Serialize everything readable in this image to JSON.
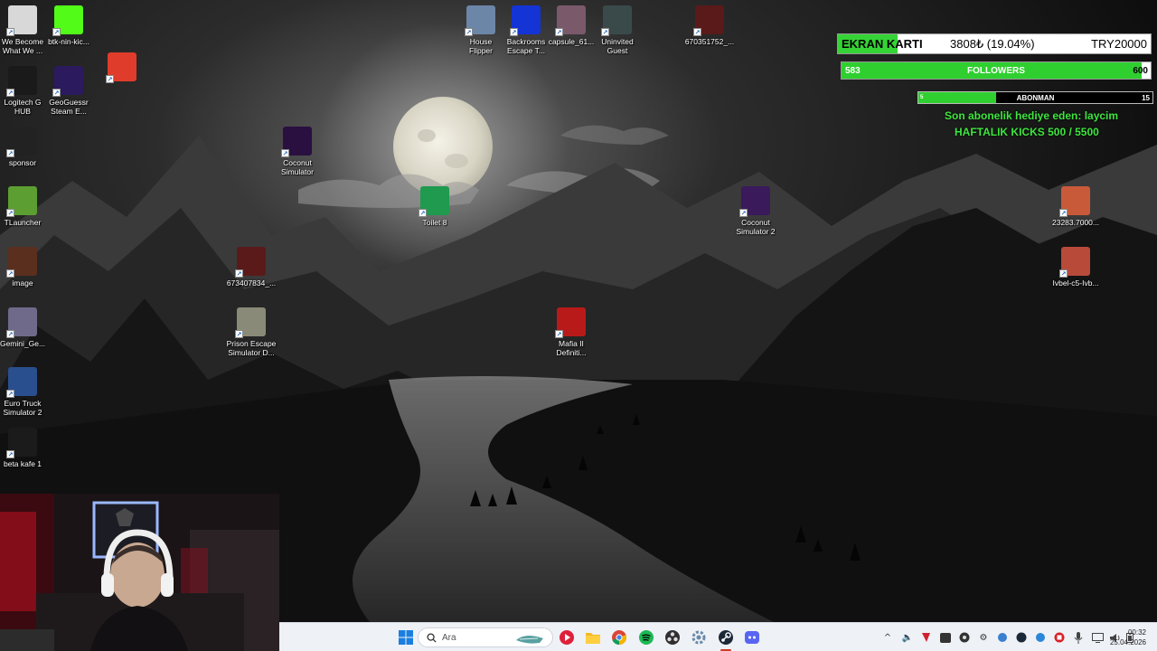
{
  "desktop": {
    "icons": [
      {
        "label": "We Become\nWhat We ...",
        "icon": "we-become-icon",
        "color": "#d8d8d8"
      },
      {
        "label": "btk-nin-kic...",
        "icon": "kick-k-icon",
        "color": "#53fc18"
      },
      {
        "label": "Logitech G\nHUB",
        "icon": "logitech-g-icon",
        "color": "#1a1a1a"
      },
      {
        "label": "GeoGuessr\nSteam E...",
        "icon": "geoguessr-pin-icon",
        "color": "#2b1a5e"
      },
      {
        "label": "",
        "icon": "pencil-stripe-icon",
        "color": "#e03c2c"
      },
      {
        "label": "sponsor",
        "icon": "sponsor-gear-icon",
        "color": "#222"
      },
      {
        "label": "TLauncher",
        "icon": "tlauncher-grass-icon",
        "color": "#5c9e31"
      },
      {
        "label": "image",
        "icon": "image-thumb-icon",
        "color": "#5a2f1e"
      },
      {
        "label": "Gemini_Ge...",
        "icon": "gemini-image-icon",
        "color": "#6f6a8a"
      },
      {
        "label": "Euro Truck\nSimulator 2",
        "icon": "truck-icon",
        "color": "#2a4f8f"
      },
      {
        "label": "beta kafe 1",
        "icon": "video-file-icon",
        "color": "#1b1b1b"
      },
      {
        "label": "House\nFlipper",
        "icon": "house-flipper-icon",
        "color": "#6c86a8"
      },
      {
        "label": "Backrooms\nEscape T...",
        "icon": "backrooms-bet-icon",
        "color": "#1434d6"
      },
      {
        "label": "capsule_61...",
        "icon": "capsule-image-icon",
        "color": "#7a5a6a"
      },
      {
        "label": "Uninvited\nGuest",
        "icon": "uninvited-guest-icon",
        "color": "#3a4a4a"
      },
      {
        "label": "670351752_...",
        "icon": "photo-file-icon",
        "color": "#5a1a1a"
      },
      {
        "label": "Coconut\nSimulator",
        "icon": "coconut-icon",
        "color": "#2a1040"
      },
      {
        "label": "Toilet 8",
        "icon": "toilet-8-icon",
        "color": "#1f9a4e"
      },
      {
        "label": "Coconut\nSimulator 2",
        "icon": "coconut-2-icon",
        "color": "#3a1a5a"
      },
      {
        "label": "673407834_...",
        "icon": "photo-file-2-icon",
        "color": "#5a1a1a"
      },
      {
        "label": "Prison Escape\nSimulator D...",
        "icon": "prison-escape-icon",
        "color": "#8a8a78"
      },
      {
        "label": "Mafia II\nDefiniti...",
        "icon": "mafia-ii-icon",
        "color": "#b81a1a"
      },
      {
        "label": "23283.7000...",
        "icon": "portrait-photo-icon",
        "color": "#c85a3a"
      },
      {
        "label": "Ivbel-c5-Ivb...",
        "icon": "portrait-photo-2-icon",
        "color": "#b84a3a"
      }
    ]
  },
  "overlay": {
    "gpu": {
      "label": "EKRAN KARTI",
      "value": "3808₺ (19.04%)",
      "goal": "TRY20000",
      "progress_pct": 19.04
    },
    "followers": {
      "current": "583",
      "label": "FOLLOWERS",
      "goal": "600",
      "progress_pct": 97.2
    },
    "subs": {
      "current": "5",
      "label": "ABONMAN",
      "goal": "15",
      "progress_pct": 33.3
    },
    "gift_text": "Son abonelik hediye eden: laycim",
    "weekly_text": "HAFTALIK KICKS 500 / 5500",
    "accent_color": "#35d335"
  },
  "taskbar": {
    "search_placeholder": "Ara",
    "apps": [
      "windows-start-icon",
      "search-icon",
      "media-player-icon",
      "file-explorer-icon",
      "chrome-icon",
      "spotify-icon",
      "obs-icon",
      "settings-app-icon",
      "steam-icon",
      "discord-icon"
    ],
    "tray": [
      "chevron-up-icon",
      "speaker-icon",
      "kick-tray-icon",
      "nvidia-tray-icon",
      "obs-tray-icon",
      "settings-tray-icon",
      "network-tray-icon",
      "steam-tray-icon",
      "bluetooth-tray-icon",
      "record-tray-icon",
      "mic-icon",
      "display-icon",
      "volume-icon",
      "battery-icon"
    ],
    "time": "00:32",
    "date": "25.04.2026"
  }
}
